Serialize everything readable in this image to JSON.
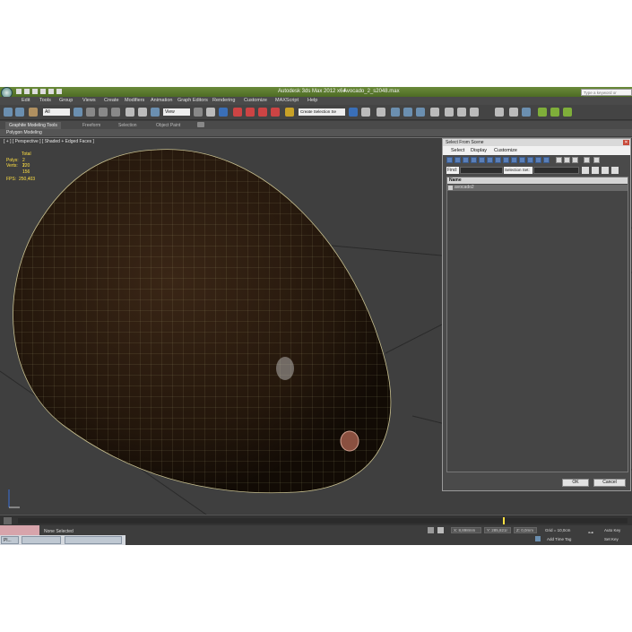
{
  "app": {
    "title": "Autodesk 3ds Max  2012 x64",
    "file": "Avocado_2_s2048.max",
    "search_placeholder": "Type a keyword or phrase"
  },
  "menu": [
    "Edit",
    "Tools",
    "Group",
    "Views",
    "Create",
    "Modifiers",
    "Animation",
    "Graph Editors",
    "Rendering",
    "Customize",
    "MAXScript",
    "Help"
  ],
  "toolbar": {
    "filter": "All",
    "view": "View",
    "selection_set": "Create Selection Se"
  },
  "ribbon": {
    "tabs": [
      "Graphite Modeling Tools",
      "Freeform",
      "Selection",
      "Object Paint"
    ],
    "active_tab": "Graphite Modeling Tools",
    "panel": "Polygon Modeling"
  },
  "viewport": {
    "label": "[ + ] [ Perspective ] [ Shaded + Edged Faces ]",
    "stats": {
      "header": "Total",
      "polys_label": "Polys:",
      "polys_value": "2 120",
      "verts_label": "Verts:",
      "verts_value": "2 156",
      "fps_label": "FPS:",
      "fps_value": "250,403"
    }
  },
  "dialog": {
    "title": "Select From Scene",
    "menu": [
      "Select",
      "Display",
      "Customize"
    ],
    "find_label": "Find:",
    "selection_set_label": "Selection Set:",
    "column_name": "Name",
    "items": [
      "avocado2"
    ],
    "ok_label": "OK",
    "cancel_label": "Cancel"
  },
  "status": {
    "selection": "None Selected",
    "x_value": "X: 8,898mm",
    "y_value": "Y: 285,821r",
    "z_value": "Z: 0,0mm",
    "grid": "Grid = 10,0cm",
    "auto_key": "Auto Key",
    "set_key": "Set Key",
    "add_time_tag": "Add Time Tag"
  },
  "taskbar": {
    "items": [
      "Pl..."
    ]
  },
  "colors": {
    "title_green": "#5a7a2e",
    "stats_yellow": "#ffe042",
    "dialog_blue": "#5a7fb8"
  }
}
